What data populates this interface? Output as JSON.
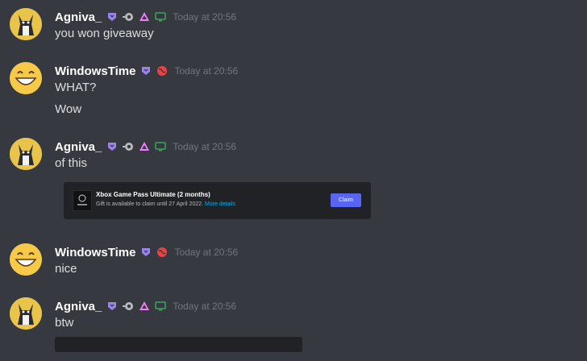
{
  "messages": [
    {
      "username": "Agniva_",
      "timestamp": "Today at 20:56",
      "lines": [
        "you won giveaway"
      ]
    },
    {
      "username": "WindowsTime",
      "timestamp": "Today at 20:56",
      "lines": [
        "WHAT?",
        "Wow"
      ]
    },
    {
      "username": "Agniva_",
      "timestamp": "Today at 20:56",
      "lines": [
        "of this"
      ]
    },
    {
      "username": "WindowsTime",
      "timestamp": "Today at 20:56",
      "lines": [
        "nice"
      ]
    },
    {
      "username": "Agniva_",
      "timestamp": "Today at 20:56",
      "lines": [
        "btw"
      ]
    }
  ],
  "gift_embed": {
    "title": "Xbox Game Pass Ultimate (2 months)",
    "subtitle": "Gift is available to claim until 27 April 2022.",
    "link": "More details",
    "button": "Claim"
  },
  "colors": {
    "background": "#36393f",
    "claim_button": "#5865f2",
    "link": "#00aff4",
    "hypesquad_purple": "#9b84ee",
    "status_green": "#3ba55d",
    "globe_red": "#ed4245"
  },
  "icons": {
    "badge_hypesquad": "hypesquad-badge-icon",
    "badge_nitro": "nitro-badge-icon",
    "badge_triangle": "triangle-badge-icon",
    "badge_monitor": "monitor-badge-icon",
    "badge_globe": "globe-badge-icon"
  }
}
